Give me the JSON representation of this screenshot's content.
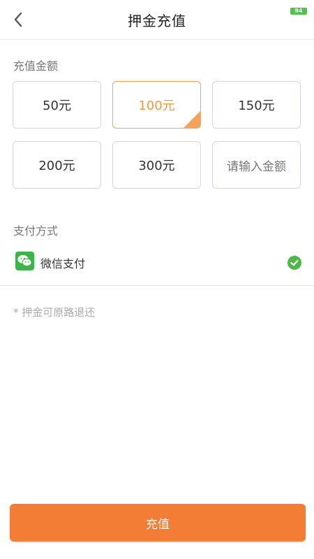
{
  "status": {
    "battery": "94"
  },
  "header": {
    "title": "押金充值"
  },
  "amount_section": {
    "label": "充值金额",
    "options": [
      "50元",
      "100元",
      "150元",
      "200元",
      "300元"
    ],
    "selected": "100元",
    "custom_placeholder": "请输入金额"
  },
  "payment_section": {
    "label": "支付方式",
    "method": "微信支付",
    "checked": true
  },
  "note": "* 押金可原路退还",
  "submit_label": "充值",
  "colors": {
    "accent": "#f47d36",
    "selected_text": "#f39a3c",
    "wechat_green": "#3cb44a",
    "check_green": "#4cb847"
  }
}
